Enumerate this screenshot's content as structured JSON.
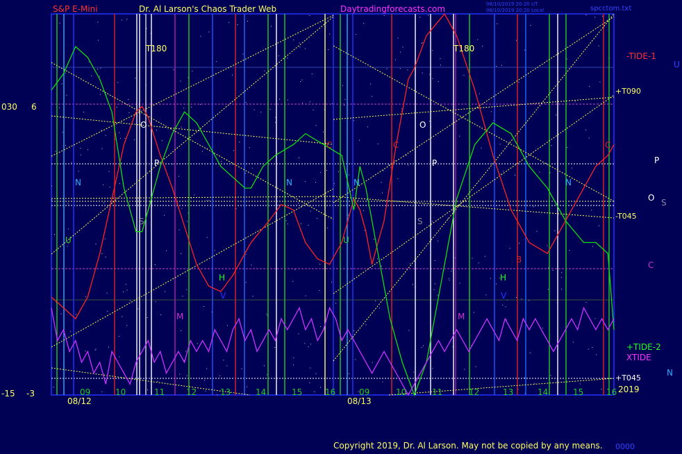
{
  "header": {
    "symbol": "S&P E-Mini",
    "site_title": "Dr. Al Larson's Chaos Trader Web",
    "site_url": "Daytradingforecasts.com",
    "timestamp_line1": "08/10/2019 20:20 UT",
    "timestamp_line2": "08/10/2019 20:20 Local",
    "file_name": "spcctom.txt"
  },
  "footer": {
    "copyright": "Copyright 2019, Dr. Al Larson. May not be copied by any means.",
    "corner_tag": "0000"
  },
  "left_axis": {
    "label_a_top": "030",
    "label_b_top": "6",
    "label_a_bottom": "-15",
    "label_b_bottom": "-3"
  },
  "right_labels": {
    "tide1": "-TIDE-1",
    "u_top": "U",
    "t090": "+T090",
    "p": "P",
    "o": "O",
    "s": "S",
    "t045m": "-T045",
    "c": "C",
    "tide2": "+TIDE-2",
    "xtide": "XTIDE",
    "n": "N",
    "t045p": "+T045",
    "year": "2019"
  },
  "chart_data": {
    "type": "line",
    "title": "S&P E-Mini",
    "x": {
      "dates": [
        "08/12",
        "08/13"
      ],
      "hour_ticks_day1": [
        "09",
        "10",
        "11",
        "12",
        "13",
        "14",
        "15",
        "16"
      ],
      "hour_ticks_day2": [
        "09",
        "10",
        "11",
        "12",
        "13",
        "14",
        "15",
        "16"
      ]
    },
    "series": [
      {
        "name": "TIDE-1",
        "color": "#ff2222",
        "points": [
          [
            0,
            -12
          ],
          [
            2,
            -13
          ],
          [
            4,
            -14
          ],
          [
            6,
            -12
          ],
          [
            8,
            -8
          ],
          [
            10,
            -3
          ],
          [
            12,
            2
          ],
          [
            14,
            5
          ],
          [
            15,
            5.5
          ],
          [
            16,
            4.5
          ],
          [
            18,
            1
          ],
          [
            20,
            -2
          ],
          [
            22,
            -5.5
          ],
          [
            24,
            -9
          ],
          [
            26,
            -11
          ],
          [
            28,
            -11.5
          ],
          [
            30,
            -10
          ],
          [
            33,
            -7
          ],
          [
            36,
            -5
          ],
          [
            38,
            -3.5
          ],
          [
            40,
            -4
          ],
          [
            42,
            -7
          ],
          [
            44,
            -8.5
          ],
          [
            46,
            -9
          ],
          [
            48,
            -7
          ],
          [
            50,
            -3
          ],
          [
            51,
            -4
          ],
          [
            52,
            -6
          ],
          [
            53,
            -9
          ],
          [
            55,
            -5
          ],
          [
            57,
            2
          ],
          [
            59,
            8
          ],
          [
            60,
            9
          ],
          [
            62,
            12
          ],
          [
            65,
            14
          ],
          [
            67,
            12
          ],
          [
            70,
            7
          ],
          [
            73,
            1
          ],
          [
            76,
            -4
          ],
          [
            79,
            -7
          ],
          [
            82,
            -8
          ],
          [
            84,
            -6
          ],
          [
            87,
            -3
          ],
          [
            90,
            0
          ],
          [
            92,
            1
          ],
          [
            93,
            2
          ]
        ]
      },
      {
        "name": "TIDE-2",
        "color": "#11dd11",
        "points": [
          [
            0,
            7
          ],
          [
            2,
            8.5
          ],
          [
            4,
            11
          ],
          [
            6,
            10
          ],
          [
            8,
            8
          ],
          [
            10,
            5
          ],
          [
            12,
            -2
          ],
          [
            14,
            -6
          ],
          [
            15,
            -6
          ],
          [
            16,
            -4
          ],
          [
            18,
            0
          ],
          [
            20,
            3
          ],
          [
            22,
            5
          ],
          [
            24,
            4
          ],
          [
            26,
            2
          ],
          [
            28,
            0
          ],
          [
            30,
            -1
          ],
          [
            32,
            -2
          ],
          [
            33,
            -2
          ],
          [
            35,
            0
          ],
          [
            37,
            1
          ],
          [
            40,
            2
          ],
          [
            42,
            3
          ],
          [
            45,
            2
          ],
          [
            48,
            1
          ],
          [
            50,
            -4
          ],
          [
            51,
            0
          ],
          [
            52,
            -2
          ],
          [
            54,
            -8
          ],
          [
            56,
            -14
          ],
          [
            58,
            -18
          ],
          [
            60,
            -21
          ],
          [
            62,
            -18
          ],
          [
            65,
            -9
          ],
          [
            67,
            -3
          ],
          [
            70,
            2
          ],
          [
            73,
            4
          ],
          [
            76,
            3
          ],
          [
            79,
            0
          ],
          [
            82,
            -2
          ],
          [
            85,
            -5
          ],
          [
            88,
            -7
          ],
          [
            90,
            -7
          ],
          [
            92,
            -8
          ],
          [
            93,
            -15
          ]
        ]
      },
      {
        "name": "XTIDE",
        "color": "#cc33ff",
        "points": [
          [
            0,
            -13
          ],
          [
            1,
            -16
          ],
          [
            2,
            -15
          ],
          [
            3,
            -17
          ],
          [
            4,
            -16
          ],
          [
            5,
            -18
          ],
          [
            6,
            -17
          ],
          [
            7,
            -19
          ],
          [
            8,
            -18
          ],
          [
            9,
            -20
          ],
          [
            10,
            -17
          ],
          [
            11,
            -18
          ],
          [
            12,
            -19
          ],
          [
            13,
            -20
          ],
          [
            14,
            -18
          ],
          [
            15,
            -17
          ],
          [
            16,
            -16
          ],
          [
            17,
            -18
          ],
          [
            18,
            -17
          ],
          [
            19,
            -19
          ],
          [
            20,
            -18
          ],
          [
            21,
            -17
          ],
          [
            22,
            -18
          ],
          [
            23,
            -16
          ],
          [
            24,
            -17
          ],
          [
            25,
            -16
          ],
          [
            26,
            -17
          ],
          [
            27,
            -15
          ],
          [
            28,
            -16
          ],
          [
            29,
            -17
          ],
          [
            30,
            -15
          ],
          [
            31,
            -14
          ],
          [
            32,
            -16
          ],
          [
            33,
            -15
          ],
          [
            34,
            -17
          ],
          [
            35,
            -16
          ],
          [
            36,
            -15
          ],
          [
            37,
            -16
          ],
          [
            38,
            -14
          ],
          [
            39,
            -15
          ],
          [
            40,
            -14
          ],
          [
            41,
            -13
          ],
          [
            42,
            -15
          ],
          [
            43,
            -14
          ],
          [
            44,
            -16
          ],
          [
            45,
            -15
          ],
          [
            46,
            -13
          ],
          [
            47,
            -14
          ],
          [
            48,
            -16
          ],
          [
            49,
            -15
          ],
          [
            50,
            -16
          ],
          [
            51,
            -17
          ],
          [
            52,
            -18
          ],
          [
            53,
            -19
          ],
          [
            54,
            -18
          ],
          [
            55,
            -17
          ],
          [
            56,
            -18
          ],
          [
            57,
            -19
          ],
          [
            58,
            -20
          ],
          [
            59,
            -21
          ],
          [
            60,
            -20
          ],
          [
            61,
            -19
          ],
          [
            62,
            -18
          ],
          [
            63,
            -17
          ],
          [
            64,
            -16
          ],
          [
            65,
            -17
          ],
          [
            66,
            -16
          ],
          [
            67,
            -15
          ],
          [
            68,
            -16
          ],
          [
            69,
            -17
          ],
          [
            70,
            -16
          ],
          [
            71,
            -15
          ],
          [
            72,
            -14
          ],
          [
            73,
            -15
          ],
          [
            74,
            -16
          ],
          [
            75,
            -14
          ],
          [
            76,
            -15
          ],
          [
            77,
            -16
          ],
          [
            78,
            -14
          ],
          [
            79,
            -15
          ],
          [
            80,
            -14
          ],
          [
            81,
            -15
          ],
          [
            82,
            -16
          ],
          [
            83,
            -17
          ],
          [
            84,
            -16
          ],
          [
            85,
            -15
          ],
          [
            86,
            -14
          ],
          [
            87,
            -15
          ],
          [
            88,
            -13
          ],
          [
            89,
            -14
          ],
          [
            90,
            -15
          ],
          [
            91,
            -14
          ],
          [
            92,
            -15
          ],
          [
            93,
            -14
          ]
        ]
      }
    ]
  }
}
